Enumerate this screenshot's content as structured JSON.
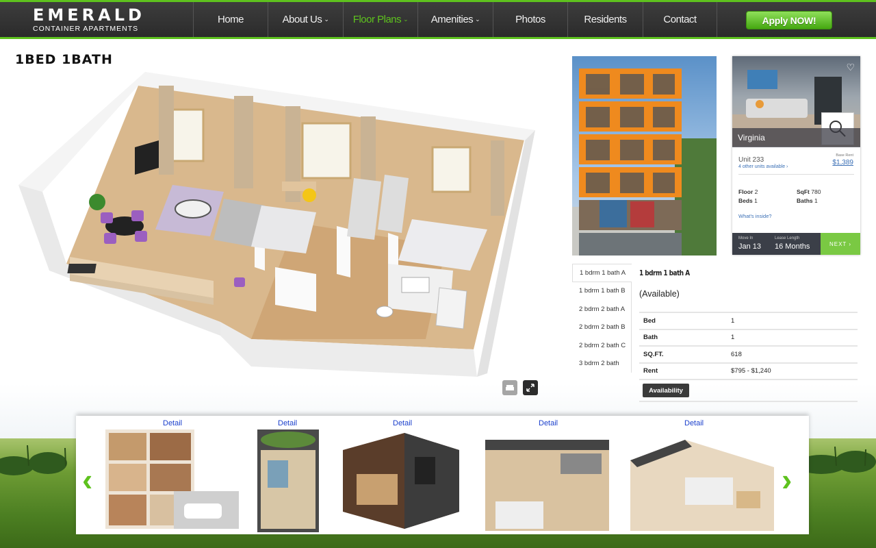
{
  "brand": {
    "logo_top": "EMERALD",
    "logo_bottom": "CONTAINER APARTMENTS",
    "accent_color": "#5ec21e"
  },
  "nav": {
    "items": [
      {
        "label": "Home",
        "dropdown": false
      },
      {
        "label": "About Us",
        "dropdown": true
      },
      {
        "label": "Floor Plans",
        "dropdown": true,
        "active": true
      },
      {
        "label": "Amenities",
        "dropdown": true
      },
      {
        "label": "Photos",
        "dropdown": false
      },
      {
        "label": "Residents",
        "dropdown": false
      },
      {
        "label": "Contact",
        "dropdown": false
      }
    ],
    "apply_label": "Apply NOW!"
  },
  "plan": {
    "title": "1BED 1BATH"
  },
  "card": {
    "name": "Virginia",
    "unit": "Unit 233",
    "other_units": "4 other units available ›",
    "base_rent_label": "Base Rent",
    "base_rent": "$1,389",
    "floor_label": "Floor",
    "floor": "2",
    "sqft_label": "SqFt",
    "sqft": "780",
    "beds_label": "Beds",
    "beds": "1",
    "baths_label": "Baths",
    "baths": "1",
    "whats_inside": "What's inside?",
    "move_in_label": "Move In",
    "move_in": "Jan 13",
    "lease_label": "Lease Length",
    "lease": "16 Months",
    "next_label": "NEXT ›"
  },
  "tabs": [
    "1 bdrm 1 bath A",
    "1 bdrm 1 bath B",
    "2 bdrm 2 bath A",
    "2 bdrm 2 bath B",
    "2 bdrm 2 bath C",
    "3 bdrm 2 bath"
  ],
  "detail": {
    "title": "1 bdrm 1 bath A",
    "status": "(Available)",
    "rows": [
      {
        "key": "Bed",
        "value": "1"
      },
      {
        "key": "Bath",
        "value": "1"
      },
      {
        "key": "SQ.FT.",
        "value": "618"
      },
      {
        "key": "Rent",
        "value": "$795 - $1,240"
      }
    ],
    "availability_label": "Availability"
  },
  "carousel": {
    "link_label": "Detail",
    "items": [
      "Detail",
      "Detail",
      "Detail",
      "Detail",
      "Detail"
    ]
  }
}
